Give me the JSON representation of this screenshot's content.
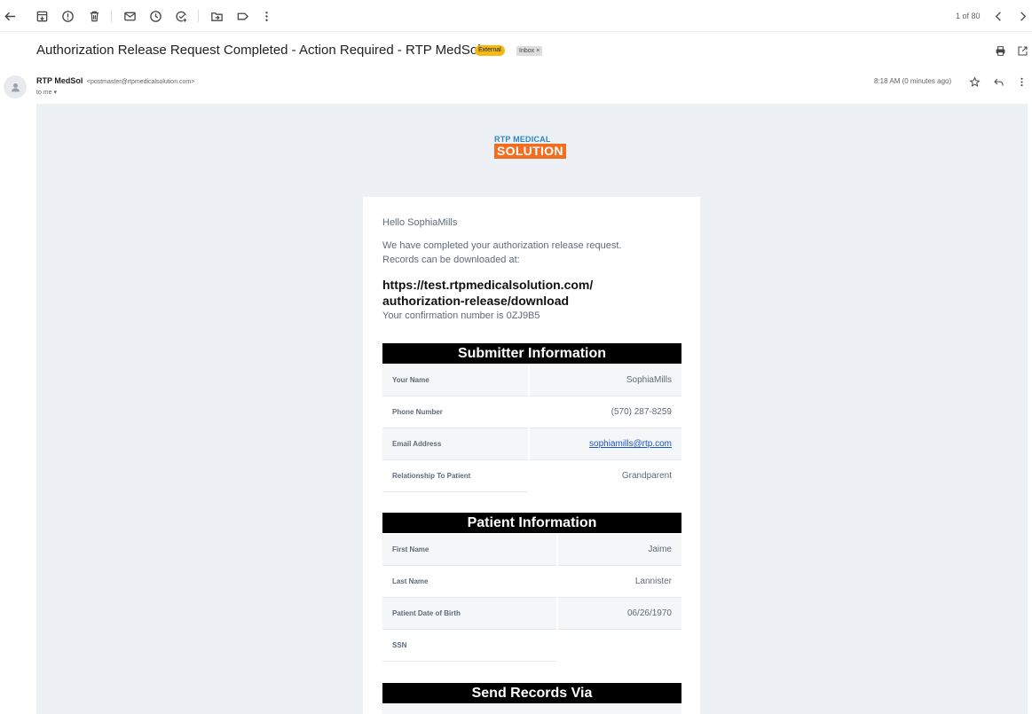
{
  "toolbar": {
    "pager_text": "1 of 80"
  },
  "message": {
    "subject": "Authorization Release Request Completed - Action Required - RTP MedSol",
    "badge_external": "External",
    "badge_inbox": "Inbox ×",
    "sender_name": "RTP MedSol",
    "sender_email": "<postmaster@rtpmedicalsolution.com>",
    "to_line": "to me ▾",
    "time": "8:18 AM (0 minutes ago)"
  },
  "logo": {
    "top_text": "RTP MEDICAL",
    "bottom_text": "SOLUTION"
  },
  "email": {
    "greeting": "Hello SophiaMills",
    "intro_line1": "We have completed your authorization release request.",
    "intro_line2": "Records can be downloaded at:",
    "url_line1": "https://test.rtpmedicalsolution.com/",
    "url_line2": "authorization-release/download",
    "confirmation": "Your confirmation number is 0ZJ9B5"
  },
  "submitter": {
    "heading": "Submitter Information",
    "rows": [
      {
        "label": "Your Name",
        "value": "SophiaMills"
      },
      {
        "label": "Phone Number",
        "value": "(570) 287-8259"
      },
      {
        "label": "Email Address",
        "value": "sophiamills@rtp.com"
      },
      {
        "label": "Relationship To Patient",
        "value": "Grandparent"
      }
    ]
  },
  "patient": {
    "heading": "Patient Information",
    "rows": [
      {
        "label": "First Name",
        "value": "Jaime"
      },
      {
        "label": "Last Name",
        "value": "Lannister"
      },
      {
        "label": "Patient Date of Birth",
        "value": "06/26/1970"
      },
      {
        "label": "SSN",
        "value": ""
      }
    ]
  },
  "send": {
    "heading": "Send Records Via"
  },
  "icons": [
    "back-arrow-icon",
    "archive-icon",
    "report-spam-icon",
    "delete-icon",
    "mark-unread-icon",
    "snooze-icon",
    "add-task-icon",
    "move-to-icon",
    "label-icon",
    "more-vert-icon",
    "prev-icon",
    "next-icon",
    "print-icon",
    "open-new-window-icon",
    "star-icon",
    "reply-icon",
    "person-icon"
  ]
}
